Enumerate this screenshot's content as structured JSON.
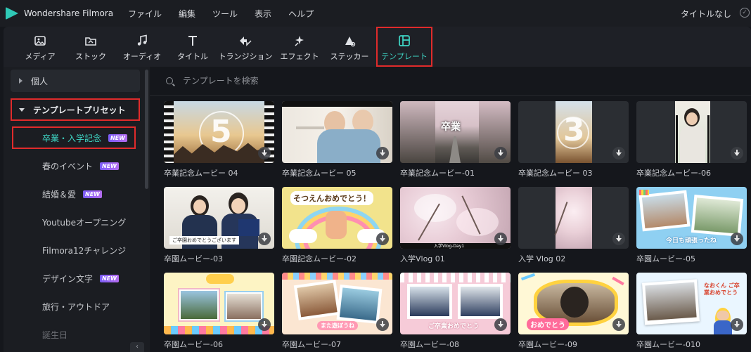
{
  "app": {
    "title": "Wondershare Filmora",
    "title_right": "タイトルなし"
  },
  "menu": [
    "ファイル",
    "編集",
    "ツール",
    "表示",
    "ヘルプ"
  ],
  "toolbar": [
    {
      "label": "メディア",
      "icon": "media-icon"
    },
    {
      "label": "ストック",
      "icon": "stock-icon"
    },
    {
      "label": "オーディオ",
      "icon": "audio-icon"
    },
    {
      "label": "タイトル",
      "icon": "title-icon"
    },
    {
      "label": "トランジション",
      "icon": "transition-icon"
    },
    {
      "label": "エフェクト",
      "icon": "effect-icon"
    },
    {
      "label": "ステッカー",
      "icon": "sticker-icon"
    },
    {
      "label": "テンプレート",
      "icon": "template-icon",
      "active": true
    }
  ],
  "sidebar": {
    "personal": "個人",
    "preset": "テンプレートプリセット",
    "items": [
      {
        "label": "卒業・入学記念",
        "new": "NEW",
        "active": true
      },
      {
        "label": "春のイベント",
        "new": "NEW"
      },
      {
        "label": "結婚＆愛",
        "new": "NEW"
      },
      {
        "label": "Youtubeオープニング"
      },
      {
        "label": "Filmora12チャレンジ"
      },
      {
        "label": "デザイン文字",
        "new": "NEW"
      },
      {
        "label": "旅行・アウトドア"
      },
      {
        "label": "誕生日"
      }
    ]
  },
  "search": {
    "placeholder": "テンプレートを検索"
  },
  "templates": [
    {
      "caption": "卒業記念ムービー 04",
      "overlay": "5"
    },
    {
      "caption": "卒業記念ムービー 05",
      "overlay": ""
    },
    {
      "caption": "卒業記念ムービー-01",
      "overlay": "卒業"
    },
    {
      "caption": "卒業記念ムービー 03",
      "overlay": "3"
    },
    {
      "caption": "卒業記念ムービー-06",
      "overlay": ""
    },
    {
      "caption": "卒園ムービー-03",
      "overlay": "ご卒園おめでとうございます"
    },
    {
      "caption": "卒園記念ムービー-02",
      "overlay": "そつえんおめでとう！"
    },
    {
      "caption": "入学Vlog 01",
      "overlay": "入学Vlog-Day1"
    },
    {
      "caption": "入学 Vlog 02",
      "overlay": ""
    },
    {
      "caption": "卒園ムービー-05",
      "overlay": "今日も頑張ったね"
    },
    {
      "caption": "卒園ムービー-06",
      "overlay": ""
    },
    {
      "caption": "卒園ムービー-07",
      "overlay": "また遊ぼうね"
    },
    {
      "caption": "卒園ムービー-08",
      "overlay": "ご卒業おめでとう"
    },
    {
      "caption": "卒園ムービー-09",
      "overlay": "おめでとう"
    },
    {
      "caption": "卒園ムービー-010",
      "overlay": "なおくん ご卒業おめでとう"
    }
  ],
  "colors": {
    "accent": "#3fd7c6",
    "highlight_box": "#e02b2b",
    "new_badge": "#8b5cf6"
  }
}
